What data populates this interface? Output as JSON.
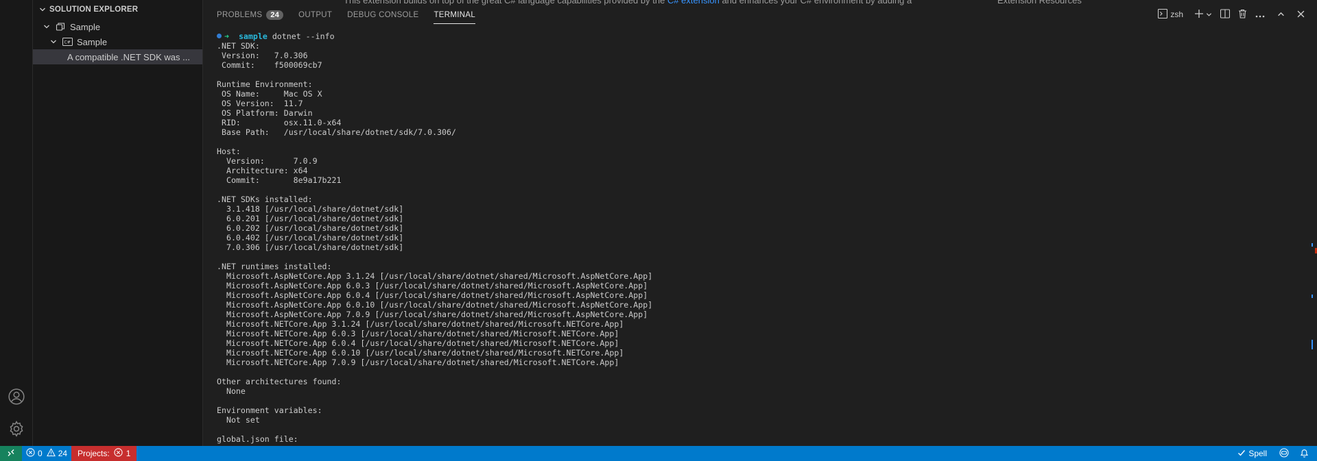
{
  "sidebar": {
    "title": "SOLUTION EXPLORER",
    "tree": [
      {
        "label": "Sample",
        "icon": "solution-icon"
      },
      {
        "label": "Sample",
        "icon": "csharp-project-icon"
      },
      {
        "label": "A compatible .NET SDK was ..."
      }
    ]
  },
  "panel": {
    "bg_text_left": "This extension builds on top of the great C# language capabilities provided by the",
    "bg_link": "C# extension",
    "bg_text_right": "and enhances your C# environment by adding a",
    "bg_text_far": "Extension Resources",
    "tabs": [
      {
        "label": "PROBLEMS",
        "badge": "24"
      },
      {
        "label": "OUTPUT"
      },
      {
        "label": "DEBUG CONSOLE"
      },
      {
        "label": "TERMINAL"
      }
    ],
    "active_tab": "TERMINAL",
    "shell_label": "zsh"
  },
  "terminal": {
    "prompt_dir": "sample",
    "prompt_cmd": " dotnet --info",
    "output": ".NET SDK:\n Version:   7.0.306\n Commit:    f500069cb7\n\nRuntime Environment:\n OS Name:     Mac OS X\n OS Version:  11.7\n OS Platform: Darwin\n RID:         osx.11.0-x64\n Base Path:   /usr/local/share/dotnet/sdk/7.0.306/\n\nHost:\n  Version:      7.0.9\n  Architecture: x64\n  Commit:       8e9a17b221\n\n.NET SDKs installed:\n  3.1.418 [/usr/local/share/dotnet/sdk]\n  6.0.201 [/usr/local/share/dotnet/sdk]\n  6.0.202 [/usr/local/share/dotnet/sdk]\n  6.0.402 [/usr/local/share/dotnet/sdk]\n  7.0.306 [/usr/local/share/dotnet/sdk]\n\n.NET runtimes installed:\n  Microsoft.AspNetCore.App 3.1.24 [/usr/local/share/dotnet/shared/Microsoft.AspNetCore.App]\n  Microsoft.AspNetCore.App 6.0.3 [/usr/local/share/dotnet/shared/Microsoft.AspNetCore.App]\n  Microsoft.AspNetCore.App 6.0.4 [/usr/local/share/dotnet/shared/Microsoft.AspNetCore.App]\n  Microsoft.AspNetCore.App 6.0.10 [/usr/local/share/dotnet/shared/Microsoft.AspNetCore.App]\n  Microsoft.AspNetCore.App 7.0.9 [/usr/local/share/dotnet/shared/Microsoft.AspNetCore.App]\n  Microsoft.NETCore.App 3.1.24 [/usr/local/share/dotnet/shared/Microsoft.NETCore.App]\n  Microsoft.NETCore.App 6.0.3 [/usr/local/share/dotnet/shared/Microsoft.NETCore.App]\n  Microsoft.NETCore.App 6.0.4 [/usr/local/share/dotnet/shared/Microsoft.NETCore.App]\n  Microsoft.NETCore.App 6.0.10 [/usr/local/share/dotnet/shared/Microsoft.NETCore.App]\n  Microsoft.NETCore.App 7.0.9 [/usr/local/share/dotnet/shared/Microsoft.NETCore.App]\n\nOther architectures found:\n  None\n\nEnvironment variables:\n  Not set\n\nglobal.json file:"
  },
  "statusbar": {
    "errors": "0",
    "warnings": "24",
    "projects_label": "Projects:",
    "projects_errors": "1",
    "spell_label": "Spell"
  },
  "colors": {
    "statusbar": "#007acc",
    "projects_error_bg": "#c72e2e",
    "remote_bg": "#16825d",
    "link": "#3794ff"
  }
}
